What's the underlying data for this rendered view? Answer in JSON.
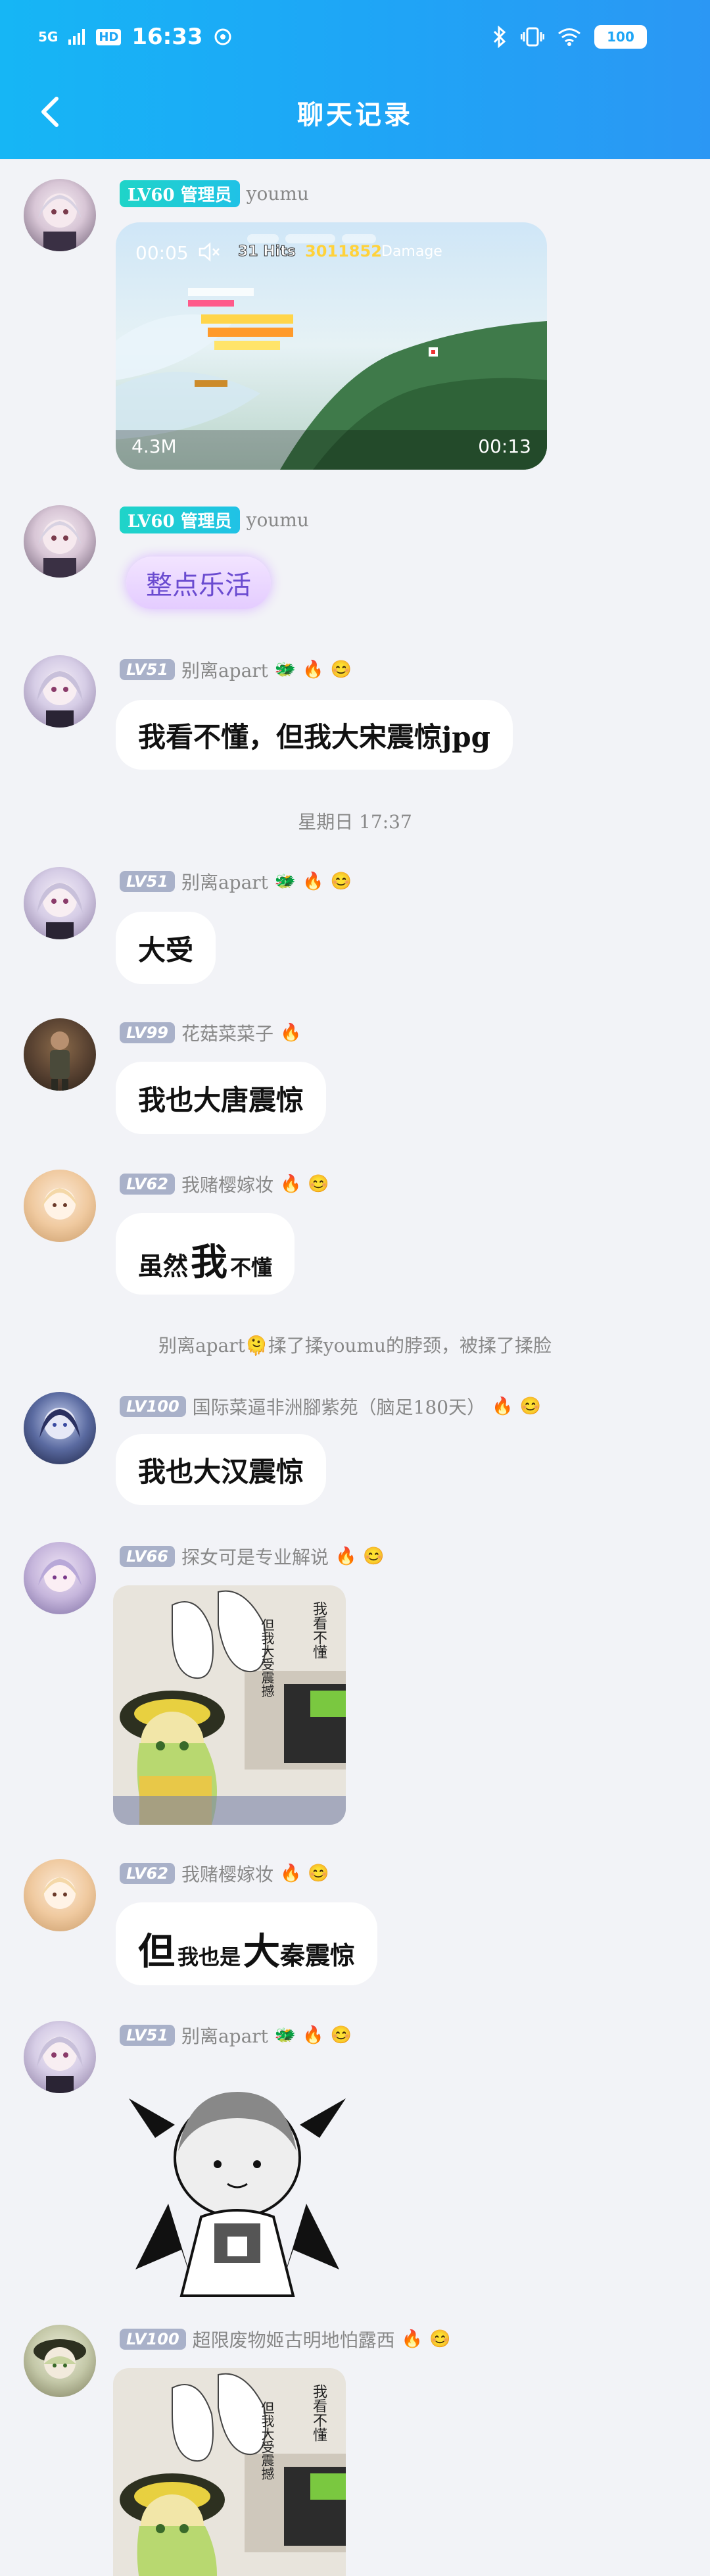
{
  "status_bar": {
    "network": "5G",
    "hd": "HD",
    "time": "16:33",
    "battery": "100"
  },
  "header": {
    "title": "聊天记录"
  },
  "messages": [
    {
      "level": "LV60",
      "role": "管理员",
      "name": "youmu",
      "video": {
        "current_time": "00:05",
        "hits": "31 Hits",
        "damage_value": "3011852",
        "damage_label": "Damage",
        "size": "4.3M",
        "duration": "00:13"
      }
    },
    {
      "level": "LV60",
      "role": "管理员",
      "name": "youmu",
      "text": "整点乐活"
    },
    {
      "level": "LV51",
      "name": "别离apart",
      "text": "我看不懂，但我大宋震惊jpg"
    },
    {
      "center_time": "星期日 17:37"
    },
    {
      "level": "LV51",
      "name": "别离apart",
      "text": "大受"
    },
    {
      "level": "LV99",
      "name": "花菇菜菜子",
      "text": "我也大唐震惊"
    },
    {
      "level": "LV62",
      "name": "我赌樱嫁妆",
      "text_parts": [
        "虽然",
        "我",
        "不懂"
      ]
    },
    {
      "system": "别离apart🫠揉了揉youmu的脖颈，被揉了揉脸"
    },
    {
      "level": "LV100",
      "name": "国际菜逼非洲腳紫苑（脑足180天）",
      "text": "我也大汉震惊"
    },
    {
      "level": "LV66",
      "name": "探女可是专业解说",
      "image_text_1": "我看不懂",
      "image_text_2": "但我大受震撼"
    },
    {
      "level": "LV62",
      "name": "我赌樱嫁妆",
      "text_parts": [
        "但",
        "我也是",
        "大",
        "秦震惊"
      ]
    },
    {
      "level": "LV51",
      "name": "别离apart"
    },
    {
      "level": "LV100",
      "name": "超限废物姬古明地怕露西",
      "image_text_1": "我看不懂",
      "image_text_2": "但我大受震撼"
    }
  ],
  "colors": {
    "header_start": "#16b6f5",
    "header_end": "#2b97f4",
    "background": "#f2f3f7",
    "level_badge": "#a9b1c9",
    "admin_badge": "#1fd4c8"
  }
}
